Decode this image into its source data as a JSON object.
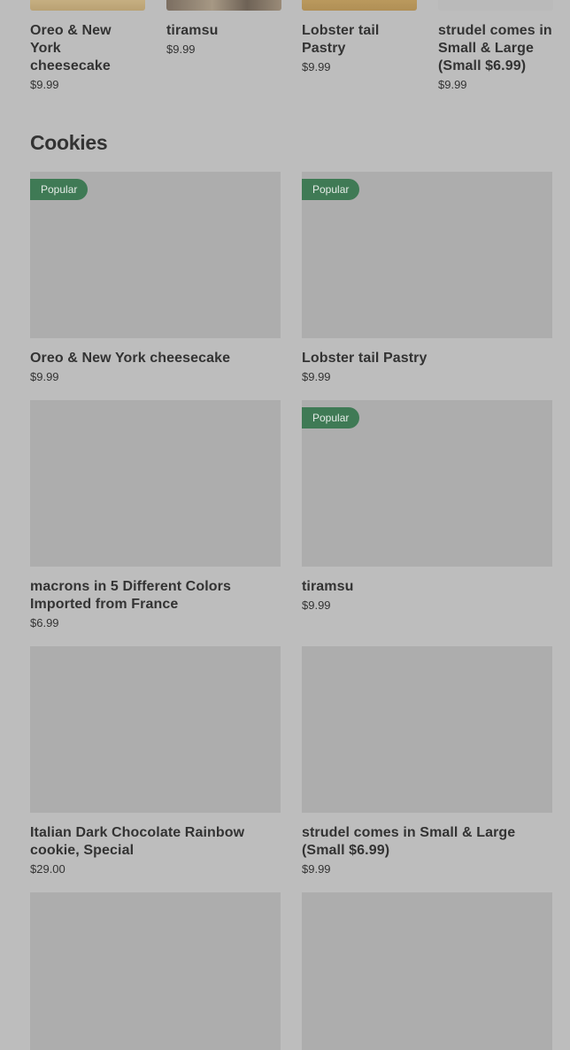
{
  "top_items": [
    {
      "name": "Oreo & New York cheesecake",
      "price": "$9.99"
    },
    {
      "name": "tiramsu",
      "price": "$9.99"
    },
    {
      "name": "Lobster tail Pastry",
      "price": "$9.99"
    },
    {
      "name": "strudel comes in Small & Large (Small $6.99)",
      "price": "$9.99"
    }
  ],
  "section": {
    "title": "Cookies",
    "badge_label": "Popular",
    "items": [
      {
        "name": "Oreo & New York cheesecake",
        "price": "$9.99",
        "popular": true
      },
      {
        "name": "Lobster tail Pastry",
        "price": "$9.99",
        "popular": true
      },
      {
        "name": "macrons in 5 Different Colors Imported from France",
        "price": "$6.99",
        "popular": false
      },
      {
        "name": "tiramsu",
        "price": "$9.99",
        "popular": true
      },
      {
        "name": "Italian Dark Chocolate Rainbow cookie, Special",
        "price": "$29.00",
        "popular": false
      },
      {
        "name": "strudel comes in Small & Large (Small $6.99)",
        "price": "$9.99",
        "popular": false
      },
      {
        "name": "",
        "price": "",
        "popular": false
      },
      {
        "name": "",
        "price": "",
        "popular": false
      }
    ]
  },
  "colors": {
    "badge": "#3f7a55",
    "background": "#bdbdbd",
    "image_placeholder": "#adadad"
  }
}
